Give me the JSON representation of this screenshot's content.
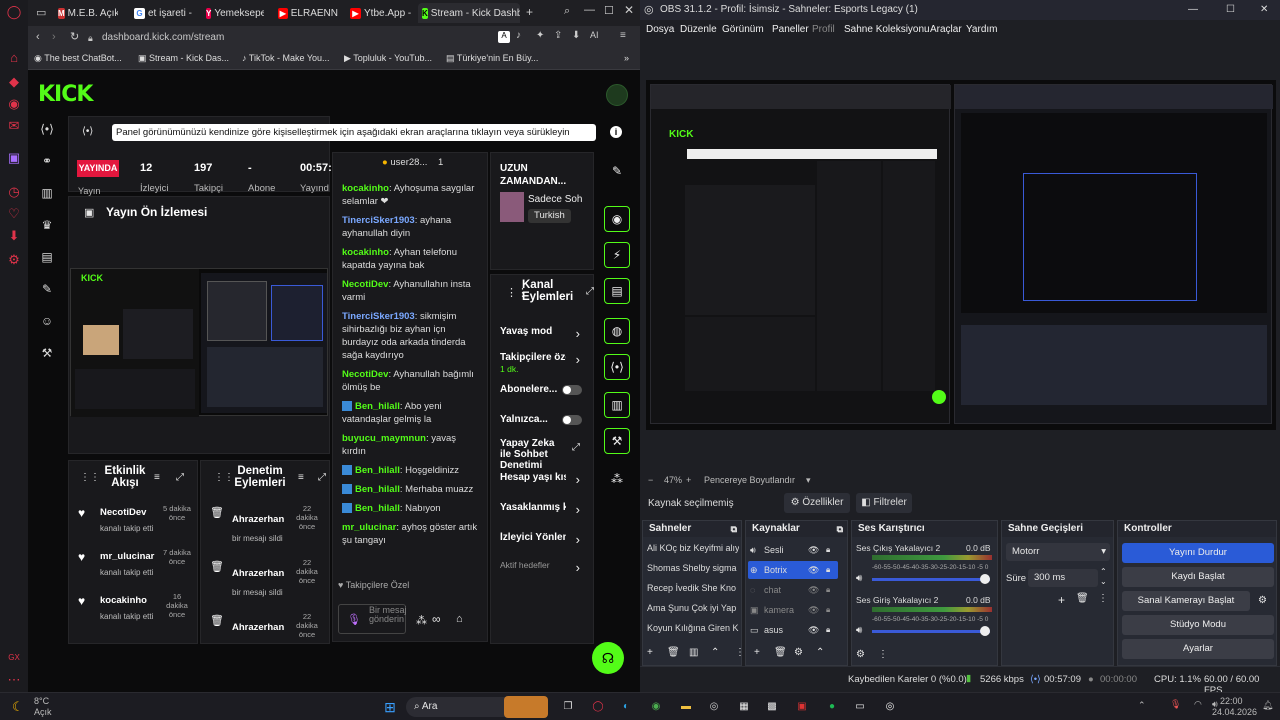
{
  "browser": {
    "tabs": [
      {
        "label": "M.E.B. Açık",
        "icon": "meb-icon"
      },
      {
        "label": "et işareti -",
        "icon": "google-icon"
      },
      {
        "label": "Yemeksepe",
        "icon": "yemeksepeti-icon"
      },
      {
        "label": "ELRAENN",
        "icon": "youtube-icon"
      },
      {
        "label": "Ytbe.App -",
        "icon": "youtube-icon"
      },
      {
        "label": "Stream - Kick Dashb",
        "icon": "kick-icon"
      }
    ],
    "url": "dashboard.kick.com/stream",
    "bookmarks": [
      "The best ChatBot...",
      "Stream - Kick Das...",
      "TikTok - Make You...",
      "Topluluk - YouTub...",
      "Türkiye'nin En Büy..."
    ]
  },
  "kick": {
    "logo": "KICK",
    "tooltip": "Panel görünümünüzü kendinize göre kişiselleştirmek için aşağıdaki ekran araçlarına tıklayın veya sürükleyin",
    "live_badge": "YAYINDA",
    "stats": [
      {
        "value": "12",
        "label": "İzleyici"
      },
      {
        "value": "197",
        "label": "Takipçi"
      },
      {
        "value": "-",
        "label": "Abone"
      },
      {
        "value": "00:57:",
        "label": "Yayınd"
      }
    ],
    "stats_extra": "Yayın",
    "preview_title": "Yayın Ön İzlemesi",
    "chat_header": "user28...",
    "chat_count": "1",
    "chat": [
      {
        "user": "kocakinho",
        "color": "#53fc18",
        "text": "Ayhoşuma saygılar selamlar ❤"
      },
      {
        "user": "TinerciSker1903",
        "color": "#7aa8ff",
        "text": "ayhana ayhanullah diyin"
      },
      {
        "user": "kocakinho",
        "color": "#53fc18",
        "text": "Ayhan telefonu kapatda yayına bak"
      },
      {
        "user": "NecotiDev",
        "color": "#53fc18",
        "text": "Ayhanullahın insta varmi"
      },
      {
        "user": "TinerciSker1903",
        "color": "#7aa8ff",
        "text": "sikmişim sihirbazlığı biz ayhan içn burdayız oda arkada tinderda sağa kaydırıyo"
      },
      {
        "user": "NecotiDev",
        "color": "#53fc18",
        "text": "Ayhanullah bağımlı ölmüş be"
      },
      {
        "user": "Ben_hilall",
        "color": "#53fc18",
        "text": "Abo yeni vatandaşlar gelmiş la",
        "bot": true
      },
      {
        "user": "buyucu_maymnun",
        "color": "#53fc18",
        "text": "yavaş kırdın"
      },
      {
        "user": "Ben_hilall",
        "color": "#53fc18",
        "text": "Hoşgeldinizz",
        "bot": true
      },
      {
        "user": "Ben_hilall",
        "color": "#53fc18",
        "text": "Merhaba muazz",
        "bot": true
      },
      {
        "user": "Ben_hilall",
        "color": "#53fc18",
        "text": "Nabıyon",
        "bot": true
      },
      {
        "user": "mr_ulucinar",
        "color": "#53fc18",
        "text": "ayhoş göster artık şu tangayı"
      }
    ],
    "chat_footer": "Takipçilere Özel",
    "chat_input_placeholder": "Bir mesaj gönderin",
    "uzun_title": "UZUN ZAMANDAN...",
    "uzun_channel": "Sadece Soh",
    "uzun_tag": "Turkish",
    "kanal_title": "Kanal Eylemleri",
    "kanal_items": [
      {
        "label": "Yavaş mod",
        "type": "arrow"
      },
      {
        "label": "Takipçilere öze",
        "sub": "1 dk.",
        "type": "arrow"
      },
      {
        "label": "Abonelere...",
        "type": "toggle"
      },
      {
        "label": "Yalnızca...",
        "type": "toggle"
      },
      {
        "label": "Yapay Zeka ile Sohbet Denetimi",
        "type": "link"
      },
      {
        "label": "Hesap yaşı kıs",
        "type": "arrow"
      },
      {
        "label": "Yasaklanmış k",
        "type": "arrow"
      },
      {
        "label": "İzleyici Yönlendir",
        "type": "arrow"
      },
      {
        "label": "Aktif hedefler",
        "type": "arrow"
      }
    ],
    "etkinlik_title": "Etkinlik Akışı",
    "etkinlik": [
      {
        "user": "NecotiDev",
        "time": "5 dakika önce",
        "sub": "kanalı takip etti"
      },
      {
        "user": "mr_ulucinar",
        "time": "7 dakika önce",
        "sub": "kanalı takip etti"
      },
      {
        "user": "kocakinho",
        "time": "16 dakika önce",
        "sub": "kanalı takip etti"
      }
    ],
    "denetim_title": "Denetim Eylemleri",
    "denetim": [
      {
        "user": "Ahrazerhan",
        "time": "22 dakika önce",
        "sub": "bir mesajı sildi"
      },
      {
        "user": "Ahrazerhan",
        "time": "22 dakika önce",
        "sub": "bir mesajı sildi"
      },
      {
        "user": "Ahrazerhan",
        "time": "22 dakika önce",
        "sub": ""
      }
    ]
  },
  "obs": {
    "title": "OBS 31.1.2 - Profil: İsimsiz - Sahneler: Esports Legacy (1)",
    "menu": [
      "Dosya",
      "Düzenle",
      "Görünüm",
      "Paneller",
      "Profil",
      "Sahne Koleksiyonu",
      "Araçlar",
      "Yardım"
    ],
    "zoom": "47%",
    "fit_label": "Pencereye Boyutlandır",
    "no_source": "Kaynak seçilmemiş",
    "properties": "Özellikler",
    "filters": "Filtreler",
    "scenes_title": "Sahneler",
    "scenes": [
      "Ali KOç biz Keyifmi alıy",
      "Shomas Shelby sigma",
      "Recep İvedik She Kno",
      "Ama Şunu Çok iyi Yap",
      "Koyun Kılığına Giren K"
    ],
    "sources_title": "Kaynaklar",
    "sources": [
      "Sesli",
      "Botrix",
      "chat",
      "kamera",
      "asus"
    ],
    "mixer_title": "Ses Karıştırıcı",
    "mixer": [
      {
        "name": "Ses Çıkış Yakalayıcı 2",
        "db": "0.0 dB"
      },
      {
        "name": "Ses Giriş Yakalayıcı 2",
        "db": "0.0 dB"
      }
    ],
    "mixer_ticks": "-60-55-50-45-40-35-30-25-20-15-10 -5  0",
    "transitions_title": "Sahne Geçişleri",
    "transition_value": "Motorr",
    "duration_label": "Süre",
    "duration_value": "300 ms",
    "controls_title": "Kontroller",
    "controls": [
      "Yayını Durdur",
      "Kaydı Başlat",
      "Sanal Kamerayı Başlat",
      "Stüdyo Modu",
      "Ayarlar"
    ],
    "status": {
      "dropped": "Kaybedilen Kareler 0 (%0.0)",
      "bitrate": "5266 kbps",
      "live_time": "00:57:09",
      "rec_time": "00:00:00",
      "cpu": "CPU: 1.1%",
      "fps": "60.00 / 60.00 FPS"
    }
  },
  "taskbar": {
    "weather_temp": "8°C",
    "weather_desc": "Açık",
    "search": "Ara",
    "time": "22:00",
    "date": "24.04.2026"
  },
  "colors": {
    "kick_green": "#53fc18",
    "obs_blue": "#2a5bd7",
    "live_red": "#e3173e"
  }
}
